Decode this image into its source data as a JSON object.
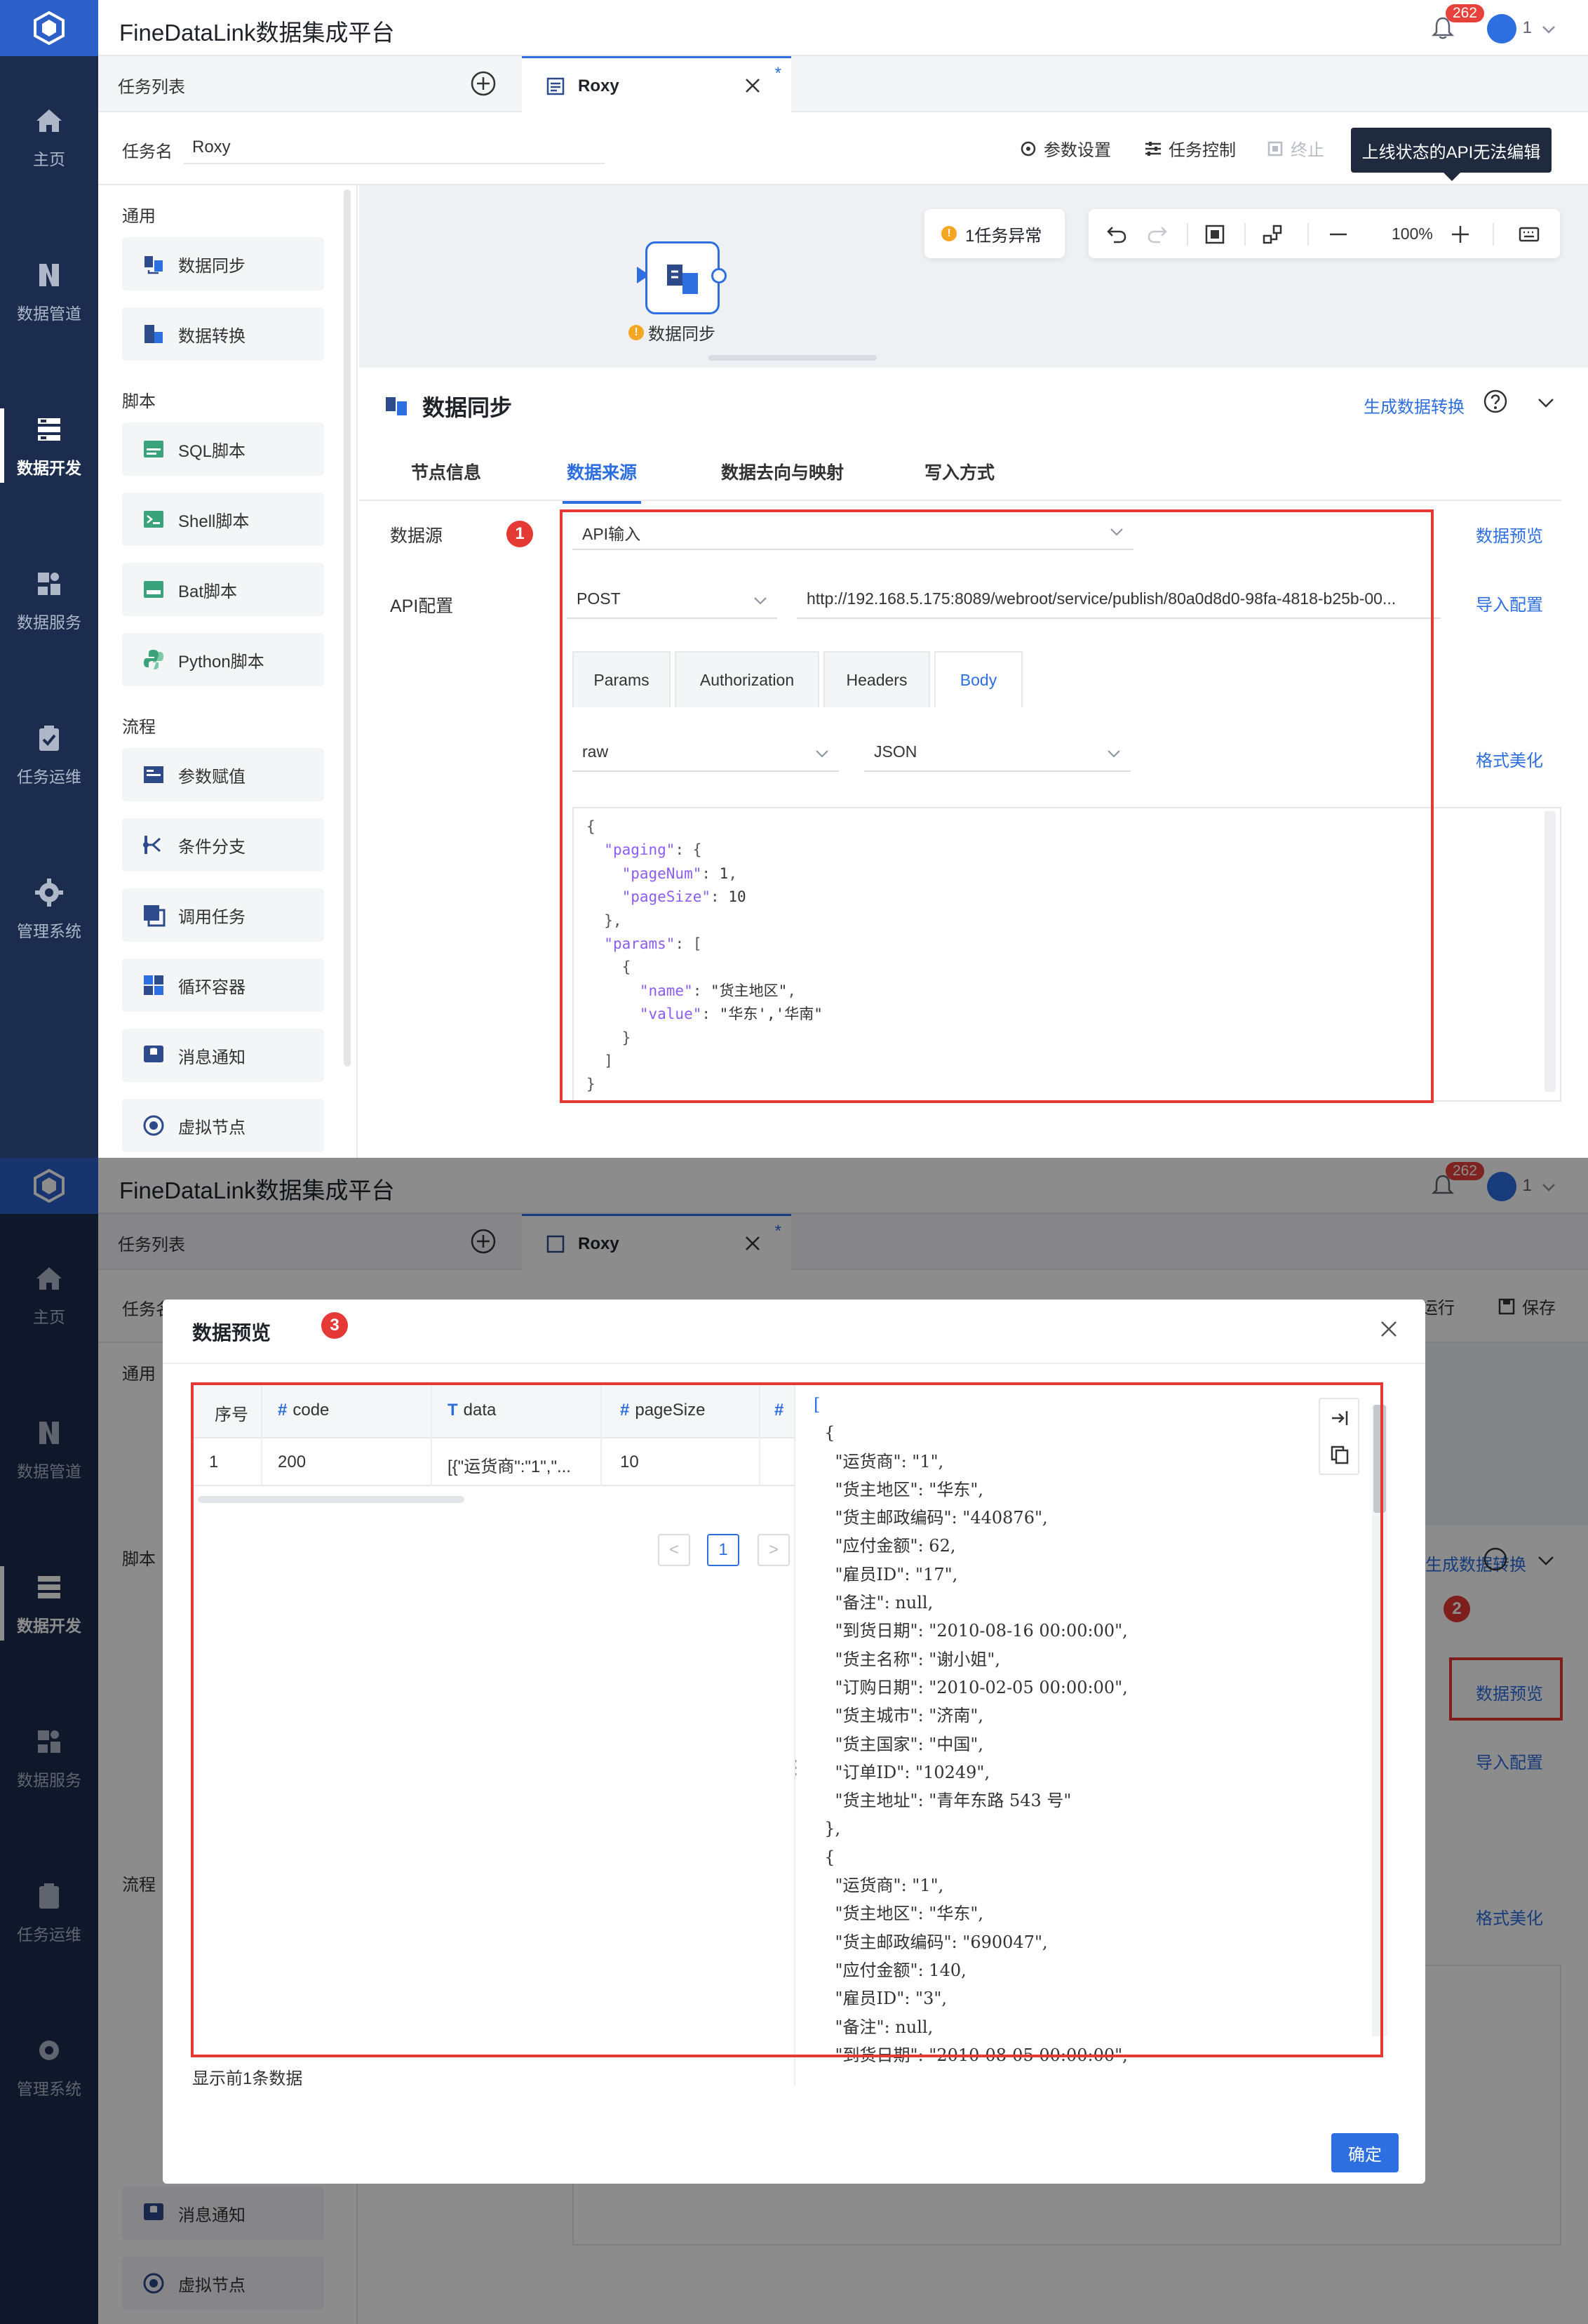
{
  "app": {
    "title": "FineDataLink数据集成平台",
    "notifications": "262",
    "user": "1"
  },
  "nav": [
    {
      "label": "主页"
    },
    {
      "label": "数据管道"
    },
    {
      "label": "数据开发"
    },
    {
      "label": "数据服务"
    },
    {
      "label": "任务运维"
    },
    {
      "label": "管理系统"
    }
  ],
  "tabs": {
    "list_label": "任务列表",
    "open_tab": "Roxy",
    "unsaved_mark": "*"
  },
  "task": {
    "name_label": "任务名",
    "name_value": "Roxy"
  },
  "toolbar": {
    "params": "参数设置",
    "control": "任务控制",
    "stop": "终止",
    "run": "运行",
    "save": "保存",
    "tooltip": "上线状态的API无法编辑"
  },
  "palette": {
    "sections": {
      "general": "通用",
      "script": "脚本",
      "flow": "流程"
    },
    "items": [
      {
        "label": "数据同步"
      },
      {
        "label": "数据转换"
      },
      {
        "label": "SQL脚本"
      },
      {
        "label": "Shell脚本"
      },
      {
        "label": "Bat脚本"
      },
      {
        "label": "Python脚本"
      },
      {
        "label": "参数赋值"
      },
      {
        "label": "条件分支"
      },
      {
        "label": "调用任务"
      },
      {
        "label": "循环容器"
      },
      {
        "label": "消息通知"
      },
      {
        "label": "虚拟节点"
      }
    ]
  },
  "canvas": {
    "exception": "1任务异常",
    "zoom": "100%",
    "node_label": "数据同步"
  },
  "detail": {
    "title": "数据同步",
    "gen_link": "生成数据转换",
    "tabs": [
      "节点信息",
      "数据来源",
      "数据去向与映射",
      "写入方式"
    ],
    "datasource_label": "数据源",
    "datasource_value": "API输入",
    "preview_link": "数据预览",
    "api_label": "API配置",
    "method": "POST",
    "url": "http://192.168.5.175:8089/webroot/service/publish/80a0d8d0-98fa-4818-b25b-00...",
    "import_link": "导入配置",
    "body_tabs": [
      "Params",
      "Authorization",
      "Headers",
      "Body"
    ],
    "body_type": "raw",
    "body_format": "JSON",
    "beautify_link": "格式美化"
  },
  "markers": [
    "1",
    "2",
    "3"
  ],
  "modal": {
    "title": "数据预览",
    "columns": [
      {
        "type": "",
        "name": "序号"
      },
      {
        "type": "#",
        "name": "code"
      },
      {
        "type": "T",
        "name": "data"
      },
      {
        "type": "#",
        "name": "pageSize"
      },
      {
        "type": "#",
        "name": ""
      }
    ],
    "row": [
      "1",
      "200",
      "[{\"运货商\":\"1\",\"...",
      "10"
    ],
    "page": "1",
    "page_prev": "<",
    "page_next": ">",
    "footer": "显示前1条数据",
    "ok": "确定"
  }
}
